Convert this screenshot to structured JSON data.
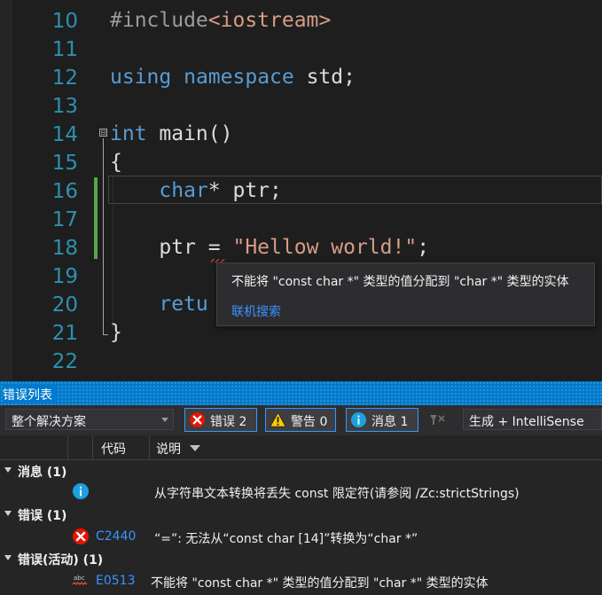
{
  "editor": {
    "lines": [
      {
        "num": "10"
      },
      {
        "num": "11"
      },
      {
        "num": "12"
      },
      {
        "num": "13"
      },
      {
        "num": "14"
      },
      {
        "num": "15"
      },
      {
        "num": "16"
      },
      {
        "num": "17"
      },
      {
        "num": "18"
      },
      {
        "num": "19"
      },
      {
        "num": "20"
      },
      {
        "num": "21"
      },
      {
        "num": "22"
      }
    ],
    "code": {
      "l10_directive": "#include",
      "l10_header": "<iostream>",
      "l12_using": "using",
      "l12_namespace": "namespace",
      "l12_rest": " std;",
      "l14_int": "int",
      "l14_rest": " main()",
      "l15": "{",
      "l16_char": "char",
      "l16_rest": "* ptr;",
      "l18_ptr": "ptr = ",
      "l18_str": "\"Hellow world!\"",
      "l18_end": ";",
      "l20_retu": "retu",
      "l21": "}"
    },
    "fold_glyph": "⊟"
  },
  "tooltip": {
    "message": "不能将 \"const char *\" 类型的值分配到 \"char *\" 类型的实体",
    "link": "联机搜索"
  },
  "error_list": {
    "title": "错误列表",
    "scope": "整个解决方案",
    "errors_btn": "错误 2",
    "warnings_btn": "警告 0",
    "messages_btn": "消息 1",
    "source": "生成 + IntelliSense",
    "columns": {
      "code": "代码",
      "description": "说明"
    },
    "groups": [
      {
        "label": "消息  (1)",
        "items": [
          {
            "icon": "info-icon",
            "code": "",
            "description": "从字符串文本转换将丢失 const 限定符(请参阅 /Zc:strictStrings)"
          }
        ]
      },
      {
        "label": "错误  (1)",
        "items": [
          {
            "icon": "error-icon",
            "code": "C2440",
            "description": "“=”: 无法从“const char [14]”转换为“char *”"
          }
        ]
      },
      {
        "label": "错误(活动)  (1)",
        "items": [
          {
            "icon": "intellisense-squiggle-icon",
            "code": "E0513",
            "description": "不能将 \"const char *\" 类型的值分配到 \"char *\" 类型的实体"
          }
        ]
      }
    ]
  },
  "colors": {
    "keyword": "#569cd6",
    "string": "#d69d85",
    "line_number": "#2b91af",
    "accent": "#007acc",
    "error": "#e51400",
    "info": "#1ba1e2",
    "warning": "#ffcc00"
  }
}
